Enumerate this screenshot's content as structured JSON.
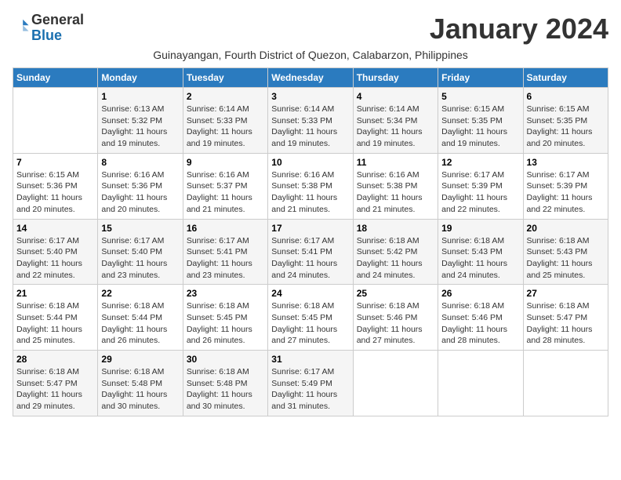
{
  "logo": {
    "text1": "General",
    "text2": "Blue"
  },
  "title": "January 2024",
  "subtitle": "Guinayangan, Fourth District of Quezon, Calabarzon, Philippines",
  "days_header": [
    "Sunday",
    "Monday",
    "Tuesday",
    "Wednesday",
    "Thursday",
    "Friday",
    "Saturday"
  ],
  "weeks": [
    [
      {
        "num": "",
        "sunrise": "",
        "sunset": "",
        "daylight": ""
      },
      {
        "num": "1",
        "sunrise": "Sunrise: 6:13 AM",
        "sunset": "Sunset: 5:32 PM",
        "daylight": "Daylight: 11 hours and 19 minutes."
      },
      {
        "num": "2",
        "sunrise": "Sunrise: 6:14 AM",
        "sunset": "Sunset: 5:33 PM",
        "daylight": "Daylight: 11 hours and 19 minutes."
      },
      {
        "num": "3",
        "sunrise": "Sunrise: 6:14 AM",
        "sunset": "Sunset: 5:33 PM",
        "daylight": "Daylight: 11 hours and 19 minutes."
      },
      {
        "num": "4",
        "sunrise": "Sunrise: 6:14 AM",
        "sunset": "Sunset: 5:34 PM",
        "daylight": "Daylight: 11 hours and 19 minutes."
      },
      {
        "num": "5",
        "sunrise": "Sunrise: 6:15 AM",
        "sunset": "Sunset: 5:35 PM",
        "daylight": "Daylight: 11 hours and 19 minutes."
      },
      {
        "num": "6",
        "sunrise": "Sunrise: 6:15 AM",
        "sunset": "Sunset: 5:35 PM",
        "daylight": "Daylight: 11 hours and 20 minutes."
      }
    ],
    [
      {
        "num": "7",
        "sunrise": "Sunrise: 6:15 AM",
        "sunset": "Sunset: 5:36 PM",
        "daylight": "Daylight: 11 hours and 20 minutes."
      },
      {
        "num": "8",
        "sunrise": "Sunrise: 6:16 AM",
        "sunset": "Sunset: 5:36 PM",
        "daylight": "Daylight: 11 hours and 20 minutes."
      },
      {
        "num": "9",
        "sunrise": "Sunrise: 6:16 AM",
        "sunset": "Sunset: 5:37 PM",
        "daylight": "Daylight: 11 hours and 21 minutes."
      },
      {
        "num": "10",
        "sunrise": "Sunrise: 6:16 AM",
        "sunset": "Sunset: 5:38 PM",
        "daylight": "Daylight: 11 hours and 21 minutes."
      },
      {
        "num": "11",
        "sunrise": "Sunrise: 6:16 AM",
        "sunset": "Sunset: 5:38 PM",
        "daylight": "Daylight: 11 hours and 21 minutes."
      },
      {
        "num": "12",
        "sunrise": "Sunrise: 6:17 AM",
        "sunset": "Sunset: 5:39 PM",
        "daylight": "Daylight: 11 hours and 22 minutes."
      },
      {
        "num": "13",
        "sunrise": "Sunrise: 6:17 AM",
        "sunset": "Sunset: 5:39 PM",
        "daylight": "Daylight: 11 hours and 22 minutes."
      }
    ],
    [
      {
        "num": "14",
        "sunrise": "Sunrise: 6:17 AM",
        "sunset": "Sunset: 5:40 PM",
        "daylight": "Daylight: 11 hours and 22 minutes."
      },
      {
        "num": "15",
        "sunrise": "Sunrise: 6:17 AM",
        "sunset": "Sunset: 5:40 PM",
        "daylight": "Daylight: 11 hours and 23 minutes."
      },
      {
        "num": "16",
        "sunrise": "Sunrise: 6:17 AM",
        "sunset": "Sunset: 5:41 PM",
        "daylight": "Daylight: 11 hours and 23 minutes."
      },
      {
        "num": "17",
        "sunrise": "Sunrise: 6:17 AM",
        "sunset": "Sunset: 5:41 PM",
        "daylight": "Daylight: 11 hours and 24 minutes."
      },
      {
        "num": "18",
        "sunrise": "Sunrise: 6:18 AM",
        "sunset": "Sunset: 5:42 PM",
        "daylight": "Daylight: 11 hours and 24 minutes."
      },
      {
        "num": "19",
        "sunrise": "Sunrise: 6:18 AM",
        "sunset": "Sunset: 5:43 PM",
        "daylight": "Daylight: 11 hours and 24 minutes."
      },
      {
        "num": "20",
        "sunrise": "Sunrise: 6:18 AM",
        "sunset": "Sunset: 5:43 PM",
        "daylight": "Daylight: 11 hours and 25 minutes."
      }
    ],
    [
      {
        "num": "21",
        "sunrise": "Sunrise: 6:18 AM",
        "sunset": "Sunset: 5:44 PM",
        "daylight": "Daylight: 11 hours and 25 minutes."
      },
      {
        "num": "22",
        "sunrise": "Sunrise: 6:18 AM",
        "sunset": "Sunset: 5:44 PM",
        "daylight": "Daylight: 11 hours and 26 minutes."
      },
      {
        "num": "23",
        "sunrise": "Sunrise: 6:18 AM",
        "sunset": "Sunset: 5:45 PM",
        "daylight": "Daylight: 11 hours and 26 minutes."
      },
      {
        "num": "24",
        "sunrise": "Sunrise: 6:18 AM",
        "sunset": "Sunset: 5:45 PM",
        "daylight": "Daylight: 11 hours and 27 minutes."
      },
      {
        "num": "25",
        "sunrise": "Sunrise: 6:18 AM",
        "sunset": "Sunset: 5:46 PM",
        "daylight": "Daylight: 11 hours and 27 minutes."
      },
      {
        "num": "26",
        "sunrise": "Sunrise: 6:18 AM",
        "sunset": "Sunset: 5:46 PM",
        "daylight": "Daylight: 11 hours and 28 minutes."
      },
      {
        "num": "27",
        "sunrise": "Sunrise: 6:18 AM",
        "sunset": "Sunset: 5:47 PM",
        "daylight": "Daylight: 11 hours and 28 minutes."
      }
    ],
    [
      {
        "num": "28",
        "sunrise": "Sunrise: 6:18 AM",
        "sunset": "Sunset: 5:47 PM",
        "daylight": "Daylight: 11 hours and 29 minutes."
      },
      {
        "num": "29",
        "sunrise": "Sunrise: 6:18 AM",
        "sunset": "Sunset: 5:48 PM",
        "daylight": "Daylight: 11 hours and 30 minutes."
      },
      {
        "num": "30",
        "sunrise": "Sunrise: 6:18 AM",
        "sunset": "Sunset: 5:48 PM",
        "daylight": "Daylight: 11 hours and 30 minutes."
      },
      {
        "num": "31",
        "sunrise": "Sunrise: 6:17 AM",
        "sunset": "Sunset: 5:49 PM",
        "daylight": "Daylight: 11 hours and 31 minutes."
      },
      {
        "num": "",
        "sunrise": "",
        "sunset": "",
        "daylight": ""
      },
      {
        "num": "",
        "sunrise": "",
        "sunset": "",
        "daylight": ""
      },
      {
        "num": "",
        "sunrise": "",
        "sunset": "",
        "daylight": ""
      }
    ]
  ]
}
